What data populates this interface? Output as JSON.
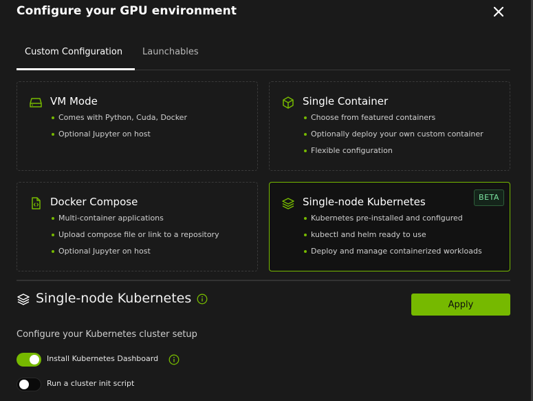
{
  "dialog": {
    "title": "Configure your GPU environment"
  },
  "tabs": [
    {
      "label": "Custom Configuration",
      "active": true
    },
    {
      "label": "Launchables",
      "active": false
    }
  ],
  "cards": [
    {
      "title": "VM Mode",
      "icon": "server-drive-icon",
      "bullets": [
        "Comes with Python, Cuda, Docker",
        "Optional Jupyter on host"
      ]
    },
    {
      "title": "Single Container",
      "icon": "cube-icon",
      "bullets": [
        "Choose from featured containers",
        "Optionally deploy your own custom container",
        "Flexible configuration"
      ]
    },
    {
      "title": "Docker Compose",
      "icon": "code-file-icon",
      "bullets": [
        "Multi-container applications",
        "Upload compose file or link to a repository",
        "Optional Jupyter on host"
      ]
    },
    {
      "title": "Single-node Kubernetes",
      "icon": "layers-icon",
      "badge": "BETA",
      "selected": true,
      "bullets": [
        "Kubernetes pre-installed and configured",
        "kubectl and helm ready to use",
        "Deploy and manage containerized workloads"
      ]
    }
  ],
  "section": {
    "title": "Single-node Kubernetes",
    "subtitle": "Configure your Kubernetes cluster setup",
    "apply_label": "Apply"
  },
  "options": [
    {
      "label": "Install Kubernetes Dashboard",
      "enabled": true,
      "has_info": true
    },
    {
      "label": "Run a cluster init script",
      "enabled": false,
      "has_info": false
    }
  ],
  "colors": {
    "accent": "#76b900",
    "background": "#1a1a1a",
    "beta_text": "#7be3a0"
  }
}
